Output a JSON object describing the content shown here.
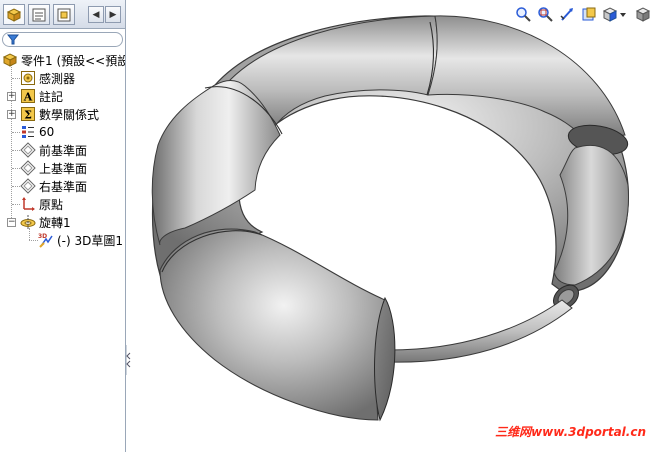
{
  "feature_tree": {
    "root_label": "零件1 (預設<<預設",
    "items": [
      {
        "label": "感測器",
        "icon": "sensor-icon"
      },
      {
        "label": "註記",
        "icon": "annotation-icon"
      },
      {
        "label": "數學關係式",
        "icon": "equations-icon"
      },
      {
        "label": "60",
        "icon": "material-icon"
      },
      {
        "label": "前基準面",
        "icon": "plane-icon"
      },
      {
        "label": "上基準面",
        "icon": "plane-icon"
      },
      {
        "label": "右基準面",
        "icon": "plane-icon"
      },
      {
        "label": "原點",
        "icon": "origin-icon"
      },
      {
        "label": "旋轉1",
        "icon": "revolve-icon"
      },
      {
        "label": "(-) 3D草圖1",
        "icon": "3d-sketch-icon"
      }
    ]
  },
  "tabs": [
    {
      "name": "feature-manager-tab",
      "icon": "feature-manager-icon"
    },
    {
      "name": "property-manager-tab",
      "icon": "property-manager-icon"
    },
    {
      "name": "configuration-manager-tab",
      "icon": "configuration-icon"
    }
  ],
  "view_toolbar": [
    "zoom-to-fit-icon",
    "zoom-to-area-icon",
    "previous-view-icon",
    "section-view-icon",
    "view-orientation-icon"
  ],
  "watermark": "三维网www.3dportal.cn",
  "colors": {
    "accent": "#ff2a1a",
    "panel_border": "#9aa7b8",
    "model_gray": "#9a9a9a"
  }
}
